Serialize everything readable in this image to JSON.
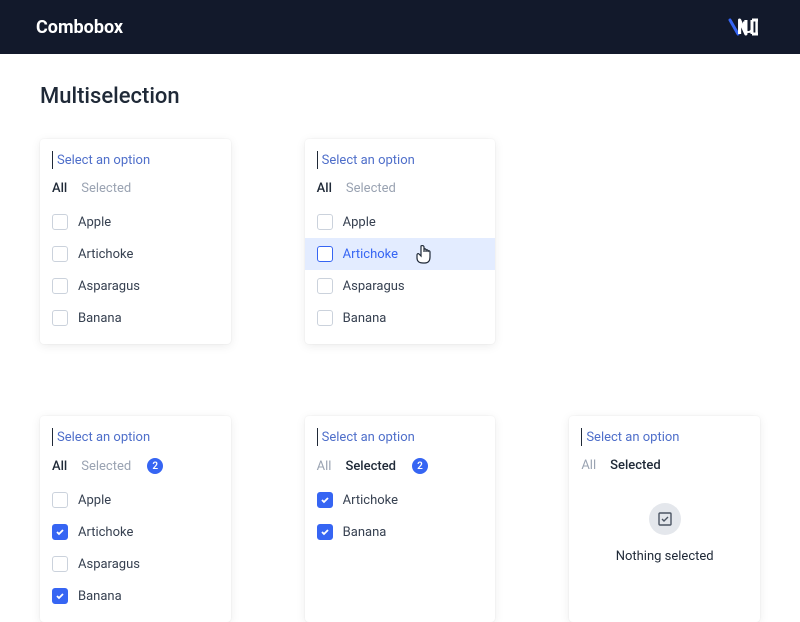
{
  "header": {
    "brand": "Combobox"
  },
  "title": "Multiselection",
  "placeholder": "Select an option",
  "tabs": {
    "all": "All",
    "selected": "Selected"
  },
  "empty": {
    "label": "Nothing selected"
  },
  "panels": [
    {
      "activeTab": "all",
      "options": [
        {
          "label": "Apple",
          "checked": false
        },
        {
          "label": "Artichoke",
          "checked": false
        },
        {
          "label": "Asparagus",
          "checked": false
        },
        {
          "label": "Banana",
          "checked": false
        }
      ]
    },
    {
      "activeTab": "all",
      "hoverIndex": 1,
      "options": [
        {
          "label": "Apple",
          "checked": false
        },
        {
          "label": "Artichoke",
          "checked": false
        },
        {
          "label": "Asparagus",
          "checked": false
        },
        {
          "label": "Banana",
          "checked": false
        }
      ]
    },
    {
      "activeTab": "all",
      "badge": 2,
      "options": [
        {
          "label": "Apple",
          "checked": false
        },
        {
          "label": "Artichoke",
          "checked": true
        },
        {
          "label": "Asparagus",
          "checked": false
        },
        {
          "label": "Banana",
          "checked": true
        }
      ]
    },
    {
      "activeTab": "selected",
      "badge": 2,
      "options": [
        {
          "label": "Artichoke",
          "checked": true
        },
        {
          "label": "Banana",
          "checked": true
        }
      ]
    },
    {
      "activeTab": "selected",
      "empty": true,
      "options": []
    }
  ]
}
